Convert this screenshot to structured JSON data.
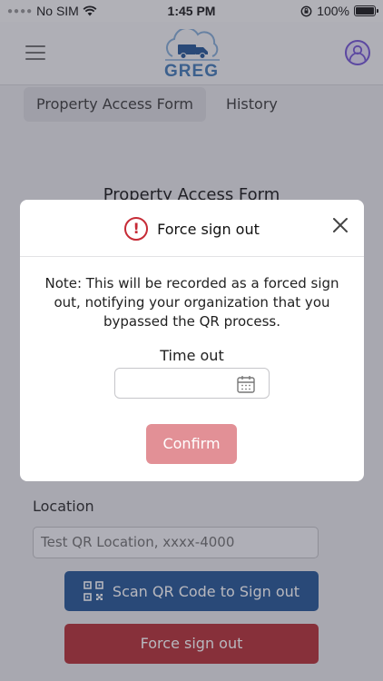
{
  "status_bar": {
    "carrier": "No SIM",
    "time": "1:45 PM",
    "battery": "100%",
    "icons": [
      "wifi-icon",
      "orientation-lock-icon",
      "battery-icon"
    ]
  },
  "header": {
    "logo_text": "GREG",
    "icons": [
      "menu-icon",
      "truck-cloud-logo",
      "user-avatar-icon"
    ]
  },
  "tabs": [
    {
      "label": "Property Access Form",
      "active": true
    },
    {
      "label": "History",
      "active": false
    }
  ],
  "form": {
    "title": "Property Access Form",
    "location_label": "Location",
    "location_value": "Test QR Location, xxxx-4000",
    "scan_button": "Scan QR Code to Sign out",
    "force_button": "Force sign out"
  },
  "modal": {
    "title": "Force sign out",
    "note": "Note: This will be recorded as a forced sign out, notifying your organization that you bypassed the QR process.",
    "time_out_label": "Time out",
    "time_out_value": "",
    "confirm_label": "Confirm"
  },
  "colors": {
    "primary_blue": "#2f5d9a",
    "danger_red": "#b8383f",
    "confirm_disabled": "#e29096",
    "alert_red": "#c62b36",
    "avatar_purple": "#7a5cd6"
  }
}
